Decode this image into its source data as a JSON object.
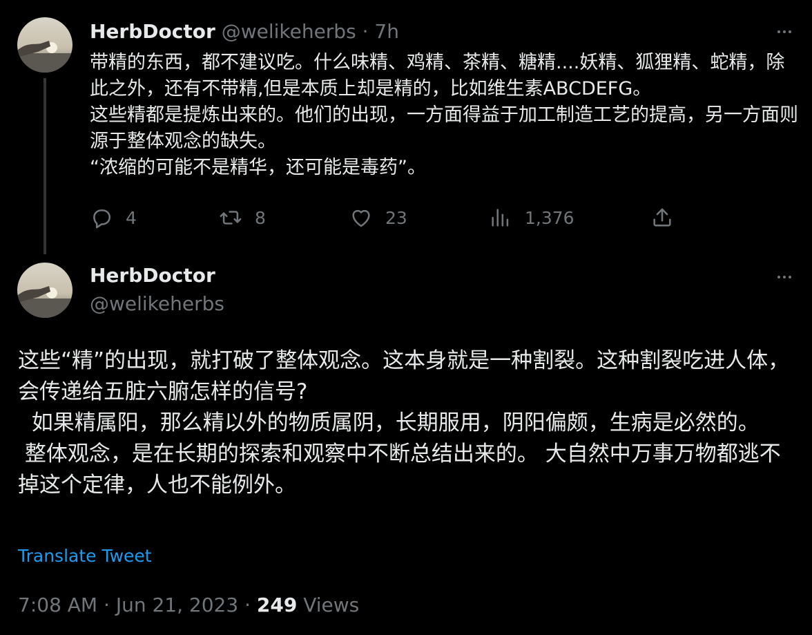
{
  "tweet1": {
    "display_name": "HerbDoctor",
    "handle": "@welikeherbs",
    "separator": "·",
    "time_ago": "7h",
    "text": "带精的东西，都不建议吃。什么味精、鸡精、茶精、糖精....妖精、狐狸精、蛇精，除此之外，还有不带精,但是本质上却是精的，比如维生素ABCDEFG。\n这些精都是提炼出来的。他们的出现，一方面得益于加工制造工艺的提高，另一方面则源于整体观念的缺失。\n“浓缩的可能不是精华，还可能是毒药”。",
    "actions": {
      "reply": {
        "icon": "reply-icon",
        "count": "4"
      },
      "retweet": {
        "icon": "retweet-icon",
        "count": "8"
      },
      "like": {
        "icon": "heart-icon",
        "count": "23"
      },
      "views": {
        "icon": "views-icon",
        "count": "1,376"
      },
      "share": {
        "icon": "share-icon"
      }
    }
  },
  "tweet2": {
    "display_name": "HerbDoctor",
    "handle": "@welikeherbs",
    "text": "这些“精”的出现，就打破了整体观念。这本身就是一种割裂。这种割裂吃进人体，会传递给五脏六腑怎样的信号?\n  如果精属阳，那么精以外的物质属阴，长期服用，阴阳偏颇，生病是必然的。\n 整体观念，是在长期的探索和观察中不断总结出来的。 大自然中万事万物都逃不掉这个定律，人也不能例外。",
    "translate_label": "Translate Tweet",
    "time": "7:08 AM",
    "dot": "·",
    "date": "Jun 21, 2023",
    "views_count": "249",
    "views_label": "Views"
  },
  "colors": {
    "background": "#000000",
    "text": "#e7e9ea",
    "muted": "#71767b",
    "link": "#1d9bf0",
    "thread_line": "#333639"
  }
}
